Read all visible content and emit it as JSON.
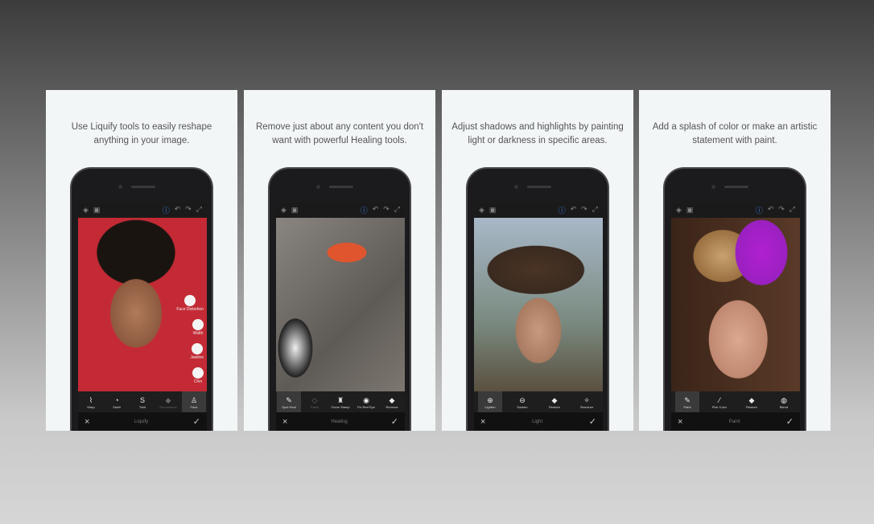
{
  "panels": [
    {
      "caption": "Use Liquify tools to easily reshape anything in your image.",
      "mode": "Liquify",
      "tools": [
        {
          "label": "Warp",
          "icon": "warp-icon",
          "glyph": "⌇"
        },
        {
          "label": "Swell",
          "icon": "swell-icon",
          "glyph": "◔"
        },
        {
          "label": "Twirl",
          "icon": "twirl-icon",
          "glyph": "S"
        },
        {
          "label": "Reconstruct",
          "icon": "eraser-icon",
          "glyph": "◆"
        },
        {
          "label": "Face",
          "icon": "face-icon",
          "glyph": "♙"
        }
      ],
      "selected": 4,
      "disabled": 3,
      "side": [
        "Face Distortion",
        "Width",
        "Jawline",
        "Chin"
      ]
    },
    {
      "caption": "Remove just about any content you don't want with powerful Healing tools.",
      "mode": "Healing",
      "tools": [
        {
          "label": "Spot Heal",
          "icon": "bandage-icon",
          "glyph": "✎"
        },
        {
          "label": "Patch",
          "icon": "patch-icon",
          "glyph": "◇"
        },
        {
          "label": "Clone Stamp",
          "icon": "stamp-icon",
          "glyph": "♜"
        },
        {
          "label": "Fix Red Eye",
          "icon": "eye-icon",
          "glyph": "◉"
        },
        {
          "label": "Remove",
          "icon": "remove-icon",
          "glyph": "◆"
        }
      ],
      "selected": 0,
      "disabled": 1
    },
    {
      "caption": "Adjust shadows and highlights by painting light or darkness in specific areas.",
      "mode": "Light",
      "tools": [
        {
          "label": "Lighten",
          "icon": "lighten-icon",
          "glyph": "⊕"
        },
        {
          "label": "Darken",
          "icon": "darken-icon",
          "glyph": "⊖"
        },
        {
          "label": "Restore",
          "icon": "eraser-icon",
          "glyph": "◆"
        },
        {
          "label": "Structure",
          "icon": "structure-icon",
          "glyph": "✧"
        }
      ],
      "selected": 0
    },
    {
      "caption": "Add a splash of color or make an artistic statement with paint.",
      "mode": "Paint",
      "tools": [
        {
          "label": "Paint",
          "icon": "brush-icon",
          "glyph": "✎"
        },
        {
          "label": "Pick Color",
          "icon": "eyedropper-icon",
          "glyph": "⁄"
        },
        {
          "label": "Restore",
          "icon": "eraser-icon",
          "glyph": "◆"
        },
        {
          "label": "Blend",
          "icon": "blend-icon",
          "glyph": "◍"
        }
      ],
      "selected": 0
    }
  ],
  "icons": {
    "cancel": "×",
    "confirm": "✓"
  },
  "colors": {
    "panel_bg": "#f3f6f7",
    "accent": "#3b82f6"
  }
}
